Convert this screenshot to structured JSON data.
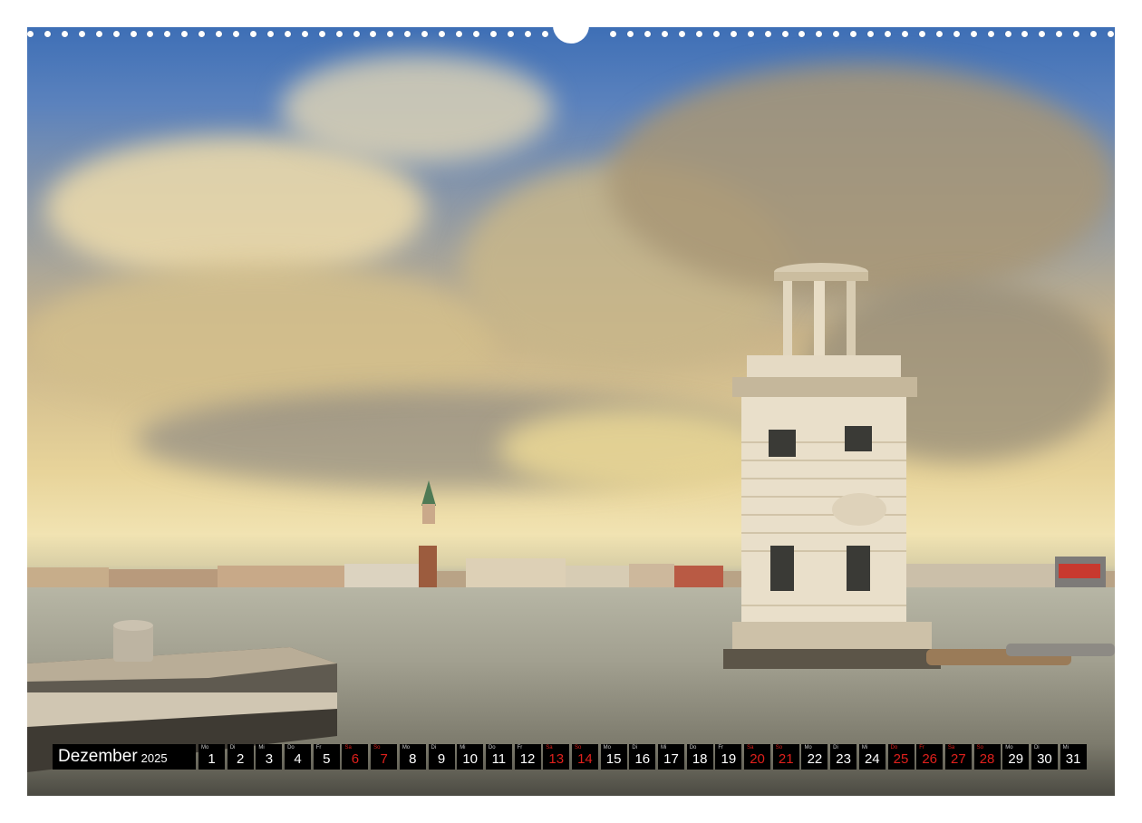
{
  "calendar": {
    "month": "Dezember",
    "year": "2025",
    "days": [
      {
        "wd": "Mo",
        "num": "1",
        "weekend": false
      },
      {
        "wd": "Di",
        "num": "2",
        "weekend": false
      },
      {
        "wd": "Mi",
        "num": "3",
        "weekend": false
      },
      {
        "wd": "Do",
        "num": "4",
        "weekend": false
      },
      {
        "wd": "Fr",
        "num": "5",
        "weekend": false
      },
      {
        "wd": "Sa",
        "num": "6",
        "weekend": true
      },
      {
        "wd": "So",
        "num": "7",
        "weekend": true
      },
      {
        "wd": "Mo",
        "num": "8",
        "weekend": false
      },
      {
        "wd": "Di",
        "num": "9",
        "weekend": false
      },
      {
        "wd": "Mi",
        "num": "10",
        "weekend": false
      },
      {
        "wd": "Do",
        "num": "11",
        "weekend": false
      },
      {
        "wd": "Fr",
        "num": "12",
        "weekend": false
      },
      {
        "wd": "Sa",
        "num": "13",
        "weekend": true
      },
      {
        "wd": "So",
        "num": "14",
        "weekend": true
      },
      {
        "wd": "Mo",
        "num": "15",
        "weekend": false
      },
      {
        "wd": "Di",
        "num": "16",
        "weekend": false
      },
      {
        "wd": "Mi",
        "num": "17",
        "weekend": false
      },
      {
        "wd": "Do",
        "num": "18",
        "weekend": false
      },
      {
        "wd": "Fr",
        "num": "19",
        "weekend": false
      },
      {
        "wd": "Sa",
        "num": "20",
        "weekend": true
      },
      {
        "wd": "So",
        "num": "21",
        "weekend": true
      },
      {
        "wd": "Mo",
        "num": "22",
        "weekend": false
      },
      {
        "wd": "Di",
        "num": "23",
        "weekend": false
      },
      {
        "wd": "Mi",
        "num": "24",
        "weekend": false
      },
      {
        "wd": "Do",
        "num": "25",
        "weekend": true
      },
      {
        "wd": "Fr",
        "num": "26",
        "weekend": true
      },
      {
        "wd": "Sa",
        "num": "27",
        "weekend": true
      },
      {
        "wd": "So",
        "num": "28",
        "weekend": true
      },
      {
        "wd": "Mo",
        "num": "29",
        "weekend": false
      },
      {
        "wd": "Di",
        "num": "30",
        "weekend": false
      },
      {
        "wd": "Mi",
        "num": "31",
        "weekend": false
      }
    ]
  },
  "colors": {
    "weekend_red": "#e0201c",
    "cell_bg": "#000000",
    "text": "#ffffff"
  }
}
